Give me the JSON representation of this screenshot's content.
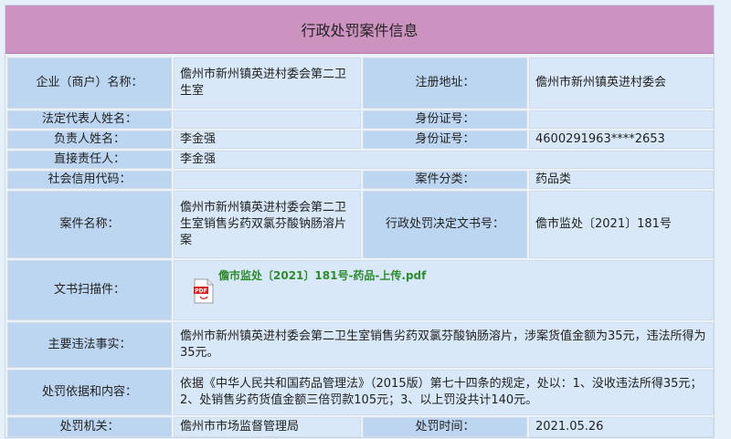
{
  "title": "行政处罚案件信息",
  "labels": {
    "company": "企业（商户）名称：",
    "reg_address": "注册地址：",
    "legal_rep": "法定代表人姓名：",
    "id_no_1": "身份证号：",
    "person_in_charge": "负责人姓名：",
    "id_no_2": "身份证号：",
    "direct_responsible": "直接责任人：",
    "credit_code": "社会信用代码：",
    "case_category": "案件分类：",
    "case_name": "案件名称：",
    "decision_doc_no": "行政处罚决定文书号：",
    "scan": "文书扫描件：",
    "main_facts": "主要违法事实：",
    "basis_content": "处罚依据和内容：",
    "authority": "处罚机关：",
    "penalty_time": "处罚时间："
  },
  "values": {
    "company": "儋州市新州镇英进村委会第二卫生室",
    "reg_address": "儋州市新州镇英进村委会",
    "legal_rep": "",
    "id_no_1": "",
    "person_in_charge": "李金强",
    "id_no_2": "4600291963****2653",
    "direct_responsible": "李金强",
    "credit_code": "",
    "case_category": "药品类",
    "case_name": "儋州市新州镇英进村委会第二卫生室销售劣药双氯芬酸钠肠溶片案",
    "decision_doc_no": "儋市监处〔2021〕181号",
    "scan_file": "儋市监处〔2021〕181号-药品-上传.pdf",
    "main_facts": "儋州市新州镇英进村委会第二卫生室销售劣药双氯芬酸钠肠溶片，涉案货值金额为35元，违法所得为35元。",
    "basis_content": "依据《中华人民共和国药品管理法》（2015版）第七十四条的规定，处以：1、没收违法所得35元；2、处销售劣药货值金额三倍罚款105元；3、以上罚没共计140元。",
    "authority": "儋州市市场监督管理局",
    "penalty_time": "2021.05.26"
  },
  "icons": {
    "pdf": "pdf-file-icon"
  },
  "colors": {
    "title_bg": "#cc92c0",
    "label_bg": "#bcd6f1",
    "value_bg": "#d8e8f8",
    "link_green": "#2e8b2e"
  }
}
